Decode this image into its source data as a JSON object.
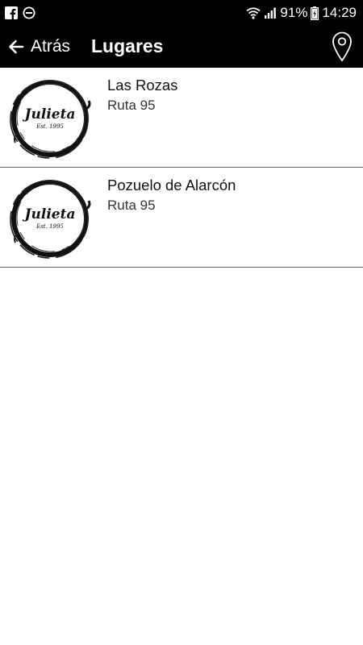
{
  "status_bar": {
    "battery": "91%",
    "time": "14:29",
    "icons": [
      "facebook-icon",
      "do-not-disturb-icon",
      "wifi-icon",
      "signal-icon",
      "battery-icon"
    ]
  },
  "app_bar": {
    "back_label": "Atrás",
    "title": "Lugares",
    "back_icon": "arrow-left-icon",
    "map_icon": "map-pin-icon"
  },
  "places": [
    {
      "name": "Las Rozas",
      "subtitle": "Ruta 95",
      "logo_text": "Julieta",
      "logo_subtext": "Est. 1995"
    },
    {
      "name": "Pozuelo de Alarcón",
      "subtitle": "Ruta 95",
      "logo_text": "Julieta",
      "logo_subtext": "Est. 1995"
    }
  ],
  "colors": {
    "bar_background": "#000000",
    "bar_text": "#ffffff",
    "divider": "#6a6a6a",
    "list_background": "#ffffff"
  }
}
